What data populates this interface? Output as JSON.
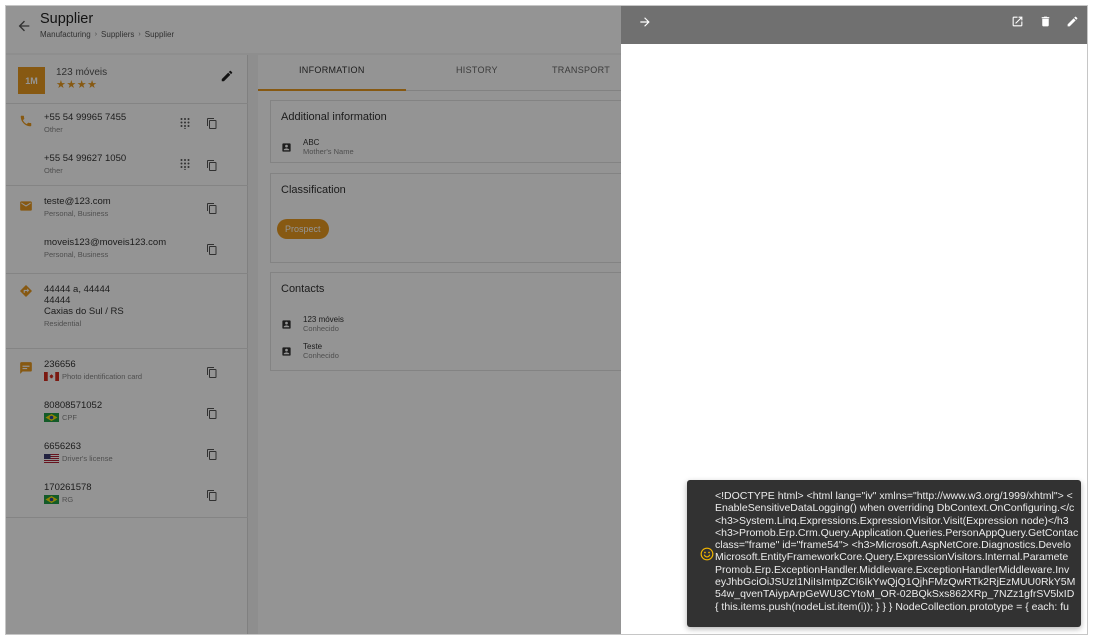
{
  "header": {
    "title": "Supplier",
    "breadcrumbs": [
      "Manufacturing",
      "Suppliers",
      "Supplier"
    ],
    "breadcrumb_separator": "›"
  },
  "profile": {
    "initials": "1M",
    "name": "123 móveis",
    "rating_stars": "★★★★",
    "rating": 4
  },
  "phones": [
    {
      "number": "+55 54 99965 7455",
      "type": "Other"
    },
    {
      "number": "+55 54 99627 1050",
      "type": "Other"
    }
  ],
  "emails": [
    {
      "address": "teste@123.com",
      "type": "Personal, Business"
    },
    {
      "address": "moveis123@moveis123.com",
      "type": "Personal, Business"
    }
  ],
  "address": {
    "line1": "44444 a, 44444",
    "line2": "44444",
    "city": "Caxias do Sul / RS",
    "type": "Residential"
  },
  "documents": [
    {
      "number": "236656",
      "type": "Photo identification card",
      "flag": "canada"
    },
    {
      "number": "80808571052",
      "type": "CPF",
      "flag": "brazil"
    },
    {
      "number": "6656263",
      "type": "Driver's license",
      "flag": "usa"
    },
    {
      "number": "170261578",
      "type": "RG",
      "flag": "brazil"
    }
  ],
  "tabs": [
    {
      "label": "INFORMATION",
      "active": true
    },
    {
      "label": "HISTORY",
      "active": false
    },
    {
      "label": "TRANSPORT",
      "active": false
    }
  ],
  "additional_info": {
    "title": "Additional information",
    "value": "ABC",
    "label": "Mother's Name"
  },
  "classification": {
    "title": "Classification",
    "chip": "Prospect"
  },
  "contacts": {
    "title": "Contacts",
    "items": [
      {
        "name": "123 móveis",
        "relation": "Conhecido"
      },
      {
        "name": "Teste",
        "relation": "Conhecido"
      }
    ]
  },
  "error_snackbar": {
    "lines": [
      "<!DOCTYPE html> <html lang=\"iv\" xmlns=\"http://www.w3.org/1999/xhtml\"> <",
      "EnableSensitiveDataLogging() when overriding DbContext.OnConfiguring.</c",
      "<h3>System.Linq.Expressions.ExpressionVisitor.Visit(Expression node)</h3",
      "<h3>Promob.Erp.Crm.Query.Application.Queries.PersonAppQuery.GetContac",
      "class=\"frame\" id=\"frame54\"> <h3>Microsoft.AspNetCore.Diagnostics.Develo",
      "Microsoft.EntityFrameworkCore.Query.ExpressionVisitors.Internal.Paramete",
      "Promob.Erp.ExceptionHandler.Middleware.ExceptionHandlerMiddleware.Inv",
      "eyJhbGciOiJSUzI1NiIsImtpZCI6IkYwQjQ1QjhFMzQwRTk2RjEzMUU0RkY5M",
      "54w_qvenTAiypArpGeWU3CYtoM_OR-02BQkSxs862XRp_7NZz1gfrSV5lxID",
      "{ this.items.push(nodeList.item(i)); } } } NodeCollection.prototype = { each: fu"
    ]
  },
  "colors": {
    "accent": "#e89a1f",
    "scrim": "rgba(0,0,0,0.42)",
    "drawer_toolbar": "#707070",
    "snackbar": "#323232"
  },
  "icons": {
    "back": "arrow-left-icon",
    "drawer_close": "arrow-right-icon",
    "open_external": "open-in-new-icon",
    "delete": "trash-icon",
    "edit": "pencil-icon"
  }
}
